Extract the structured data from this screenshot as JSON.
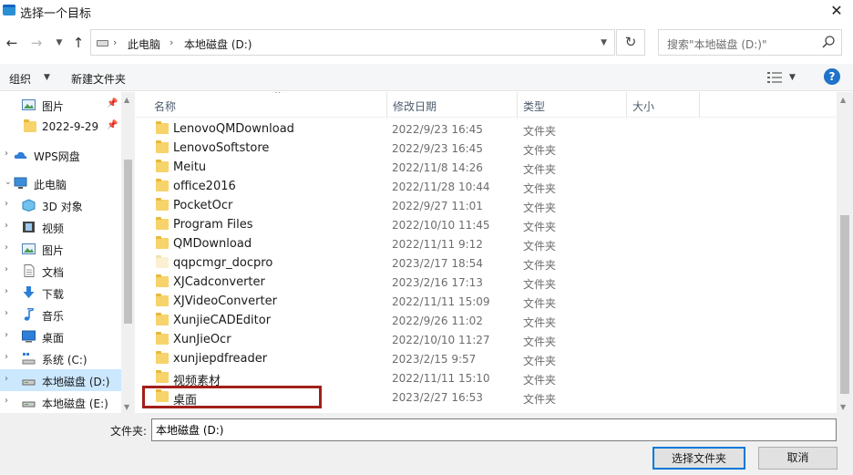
{
  "window": {
    "title": "选择一个目标",
    "close_glyph": "✕"
  },
  "address": {
    "crumbs": [
      "此电脑",
      "本地磁盘 (D:)"
    ],
    "separator": "›",
    "search_placeholder": "搜索\"本地磁盘 (D:)\""
  },
  "toolbar": {
    "organize": "组织",
    "new_folder": "新建文件夹",
    "help": "?"
  },
  "nav": {
    "items": [
      {
        "label": "图片",
        "icon": "pictures-icon",
        "pinned": true
      },
      {
        "label": "2022-9-29",
        "icon": "folder-icon",
        "pinned": true
      },
      {
        "label": "WPS网盘",
        "icon": "cloud-icon"
      },
      {
        "label": "此电脑",
        "icon": "computer-icon"
      },
      {
        "label": "3D 对象",
        "icon": "3d-objects-icon"
      },
      {
        "label": "视频",
        "icon": "video-icon"
      },
      {
        "label": "图片",
        "icon": "pictures-icon"
      },
      {
        "label": "文档",
        "icon": "document-icon"
      },
      {
        "label": "下载",
        "icon": "download-icon"
      },
      {
        "label": "音乐",
        "icon": "music-icon"
      },
      {
        "label": "桌面",
        "icon": "desktop-icon"
      },
      {
        "label": "系统 (C:)",
        "icon": "system-drive-icon"
      },
      {
        "label": "本地磁盘 (D:)",
        "icon": "drive-icon",
        "selected": true
      },
      {
        "label": "本地磁盘 (E:)",
        "icon": "drive-icon"
      }
    ]
  },
  "columns": {
    "name": "名称",
    "modified": "修改日期",
    "type": "类型",
    "size": "大小"
  },
  "files": [
    {
      "name": "LenovoQMDownload",
      "date": "2022/9/23 16:45",
      "type": "文件夹"
    },
    {
      "name": "LenovoSoftstore",
      "date": "2022/9/23 16:45",
      "type": "文件夹"
    },
    {
      "name": "Meitu",
      "date": "2022/11/8 14:26",
      "type": "文件夹"
    },
    {
      "name": "office2016",
      "date": "2022/11/28 10:44",
      "type": "文件夹"
    },
    {
      "name": "PocketOcr",
      "date": "2022/9/27 11:01",
      "type": "文件夹"
    },
    {
      "name": "Program Files",
      "date": "2022/10/10 11:45",
      "type": "文件夹"
    },
    {
      "name": "QMDownload",
      "date": "2022/11/11 9:12",
      "type": "文件夹"
    },
    {
      "name": "qqpcmgr_docpro",
      "date": "2023/2/17 18:54",
      "type": "文件夹",
      "pale": true
    },
    {
      "name": "XJCadconverter",
      "date": "2023/2/16 17:13",
      "type": "文件夹"
    },
    {
      "name": "XJVideoConverter",
      "date": "2022/11/11 15:09",
      "type": "文件夹"
    },
    {
      "name": "XunjieCADEditor",
      "date": "2022/9/26 11:02",
      "type": "文件夹"
    },
    {
      "name": "XunJieOcr",
      "date": "2022/10/10 11:27",
      "type": "文件夹"
    },
    {
      "name": "xunjiepdfreader",
      "date": "2023/2/15 9:57",
      "type": "文件夹"
    },
    {
      "name": "视频素材",
      "date": "2022/11/11 15:10",
      "type": "文件夹"
    },
    {
      "name": "桌面",
      "date": "2023/2/27 16:53",
      "type": "文件夹",
      "highlighted": true
    }
  ],
  "bottom": {
    "folder_label": "文件夹:",
    "folder_value": "本地磁盘 (D:)",
    "select_button": "选择文件夹",
    "cancel_button": "取消"
  },
  "colors": {
    "accent": "#0078d7",
    "selection": "#cce8ff",
    "folder": "#f7d36b",
    "highlight_border": "#a11f1a"
  }
}
